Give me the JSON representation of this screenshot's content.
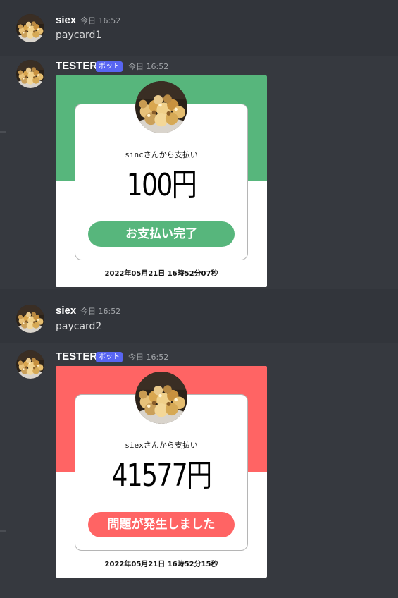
{
  "colors": {
    "success": "#57b67c",
    "error": "#ff6464",
    "bot_tag": "#5865f2",
    "background": "#36393f"
  },
  "avatar_icon": "popcorn-avatar",
  "messages": [
    {
      "author": "siex",
      "timestamp": "今日 16:52",
      "text": "paycard1"
    },
    {
      "author": "TESTER",
      "bot_tag": "ボット",
      "timestamp": "今日 16:52",
      "card": {
        "variant": "success",
        "sender_line": "sincさんから支払い",
        "amount": "100円",
        "status": "お支払い完了",
        "date": "2022年05月21日  16時52分07秒"
      }
    },
    {
      "author": "siex",
      "timestamp": "今日 16:52",
      "text": "paycard2"
    },
    {
      "author": "TESTER",
      "bot_tag": "ボット",
      "timestamp": "今日 16:52",
      "card": {
        "variant": "error",
        "sender_line": "siexさんから支払い",
        "amount": "41577円",
        "status": "問題が発生しました",
        "date": "2022年05月21日  16時52分15秒"
      }
    }
  ]
}
